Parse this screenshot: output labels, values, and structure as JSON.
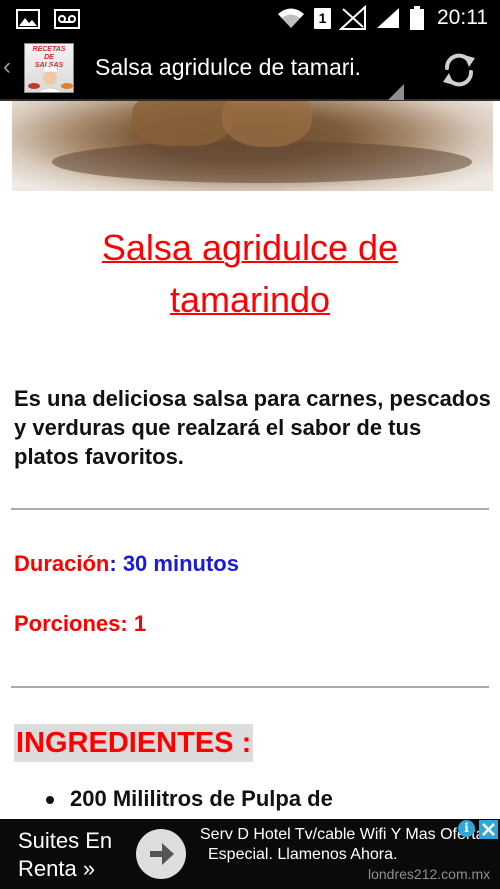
{
  "status_bar": {
    "time": "20:11",
    "sim_slot": "1",
    "icons": [
      "image-icon",
      "voicemail-icon",
      "wifi-icon",
      "sim-icon",
      "no-signal-icon",
      "signal-icon",
      "battery-icon"
    ]
  },
  "action_bar": {
    "title": "Salsa agridulce de tamari.",
    "logo_line1": "RECETAS",
    "logo_line2": "DE",
    "logo_line3": "SALSAS",
    "icons": [
      "back-chevron-icon",
      "refresh-icon"
    ]
  },
  "recipe": {
    "title_line1": "Salsa agridulce de",
    "title_line2": "tamarindo",
    "intro": "Es una deliciosa salsa para carnes, pescados y verduras que realzará el sabor de tus platos favoritos.",
    "duration_label": "Duración",
    "duration_separator": ":",
    "duration_value": "30 minutos",
    "portions_label": "Porciones:",
    "portions_value": "1",
    "ingredients_heading": "INGREDIENTES :",
    "ingredients": [
      "200 Mililitros de Pulpa de"
    ]
  },
  "ad": {
    "left_line1": "Suites En",
    "left_line2": "Renta »",
    "main_line1": "Serv D Hotel Tv/cable Wifi Y Mas Ofertas",
    "main_line2": "Especial. Llamenos Ahora.",
    "url": "londres212.com.mx",
    "info_glyph": "i",
    "accent_color": "#2fa6d8"
  },
  "colors": {
    "title_red": "#ff0000",
    "value_blue": "#1a1ad8",
    "heading_bg": "#dcdcdc"
  }
}
